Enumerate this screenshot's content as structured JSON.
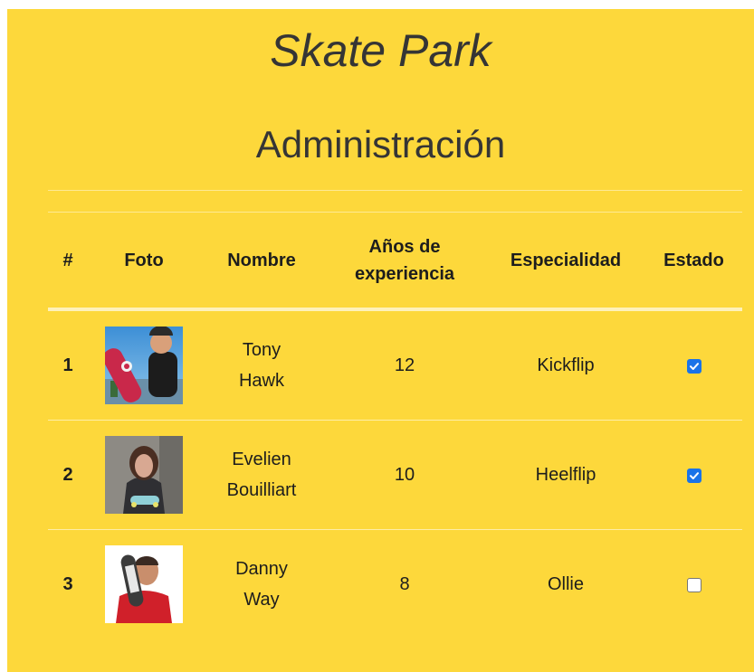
{
  "page": {
    "title": "Skate Park",
    "subtitle": "Administración"
  },
  "table": {
    "headers": [
      "#",
      "Foto",
      "Nombre",
      "Años de experiencia",
      "Especialidad",
      "Estado"
    ],
    "rows": [
      {
        "index": "1",
        "name": "Tony Hawk",
        "experience": "12",
        "specialty": "Kickflip",
        "checked": true,
        "photo": "skater-photo-1"
      },
      {
        "index": "2",
        "name": "Evelien Bouilliart",
        "experience": "10",
        "specialty": "Heelflip",
        "checked": true,
        "photo": "skater-photo-2"
      },
      {
        "index": "3",
        "name": "Danny Way",
        "experience": "8",
        "specialty": "Ollie",
        "checked": false,
        "photo": "skater-photo-3"
      }
    ]
  },
  "colors": {
    "background": "#fdd83b",
    "text": "#353535",
    "checkbox": "#1a73e8"
  }
}
